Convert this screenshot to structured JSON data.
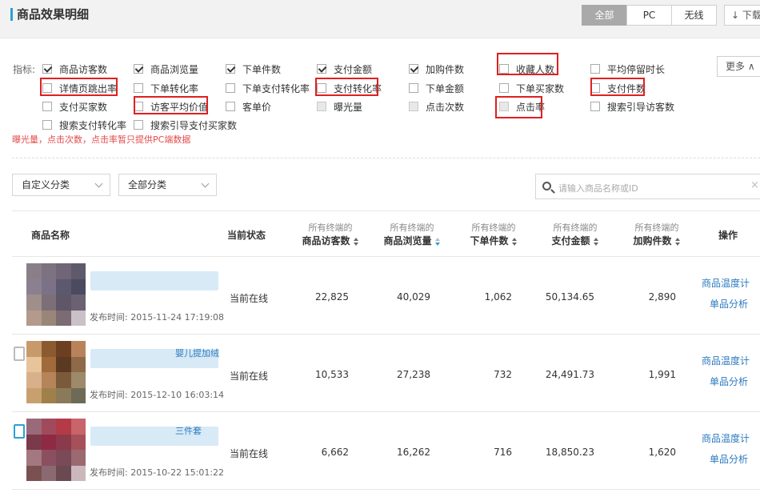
{
  "header": {
    "title": "商品效果明细",
    "segments": [
      "全部",
      "PC",
      "无线"
    ],
    "active_segment": "全部",
    "download_label": "↓ 下载"
  },
  "indicators": {
    "label": "指标:",
    "more_label": "更多 ∧",
    "items": [
      {
        "label": "商品访客数",
        "checked": true
      },
      {
        "label": "商品浏览量",
        "checked": true
      },
      {
        "label": "下单件数",
        "checked": true
      },
      {
        "label": "支付金额",
        "checked": true
      },
      {
        "label": "加购件数",
        "checked": true
      },
      {
        "label": "收藏人数",
        "checked": false
      },
      {
        "label": "平均停留时长",
        "checked": false
      },
      {
        "label": "详情页跳出率",
        "checked": false
      },
      {
        "label": "下单转化率",
        "checked": false
      },
      {
        "label": "下单支付转化率",
        "checked": false
      },
      {
        "label": "支付转化率",
        "checked": false
      },
      {
        "label": "下单金额",
        "checked": false
      },
      {
        "label": "下单买家数",
        "checked": false
      },
      {
        "label": "支付件数",
        "checked": false
      },
      {
        "label": "支付买家数",
        "checked": false
      },
      {
        "label": "访客平均价值",
        "checked": false
      },
      {
        "label": "客单价",
        "checked": false
      },
      {
        "label": "曝光量",
        "checked": false
      },
      {
        "label": "点击次数",
        "checked": false
      },
      {
        "label": "点击率",
        "checked": false
      },
      {
        "label": "搜索引导访客数",
        "checked": false
      },
      {
        "label": "搜索支付转化率",
        "checked": false
      },
      {
        "label": "搜索引导支付买家数",
        "checked": false
      }
    ],
    "note": "曝光量，点击次数，点击率暂只提供PC端数据"
  },
  "filters": {
    "custom_category": "自定义分类",
    "all_category": "全部分类",
    "search_placeholder": "请输入商品名称或ID",
    "search_clear": "×"
  },
  "table": {
    "headers": {
      "name": "商品名称",
      "status": "当前状态",
      "sub": "所有终端的",
      "visitors": "商品访客数",
      "pageviews": "商品浏览量",
      "orders": "下单件数",
      "paid": "支付金额",
      "cart": "加购件数",
      "op": "操作"
    },
    "rows": [
      {
        "name_fragment": "",
        "publish": "发布时间: 2015-11-24 17:19:08",
        "status": "当前在线",
        "visitors": "22,825",
        "pageviews": "40,029",
        "orders": "1,062",
        "paid": "50,134.65",
        "cart": "2,890",
        "op1": "商品温度计",
        "op2": "单品分析"
      },
      {
        "name_fragment": "婴儿提加绒",
        "publish": "发布时间: 2015-12-10 16:03:14",
        "status": "当前在线",
        "visitors": "10,533",
        "pageviews": "27,238",
        "orders": "732",
        "paid": "24,491.73",
        "cart": "1,991",
        "op1": "商品温度计",
        "op2": "单品分析"
      },
      {
        "name_fragment": "三件套",
        "publish": "发布时间: 2015-10-22 15:01:22",
        "status": "当前在线",
        "visitors": "6,662",
        "pageviews": "16,262",
        "orders": "716",
        "paid": "18,850.23",
        "cart": "1,620",
        "op1": "商品温度计",
        "op2": "单品分析"
      }
    ]
  },
  "colors": {
    "accent": "#2aa0d8",
    "link": "#2a79c0",
    "highlight_box": "#e02020",
    "note": "#e34b4b"
  }
}
